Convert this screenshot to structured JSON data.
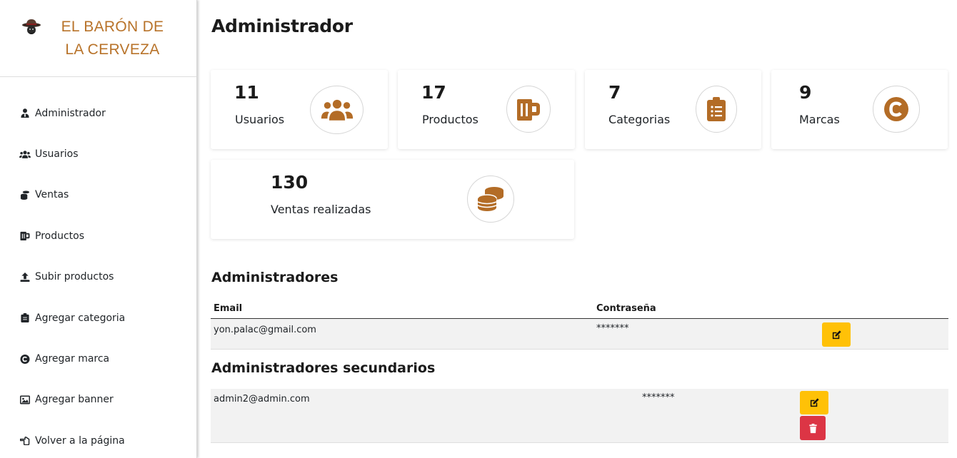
{
  "brand": {
    "name": "EL BARÓN DE LA CERVEZA",
    "logo_icon": "baron-hat-logo-icon",
    "color": "#b8732a"
  },
  "sidebar": {
    "items": [
      {
        "label": "Administrador",
        "icon": "user-tie-icon"
      },
      {
        "label": "Usuarios",
        "icon": "users-icon"
      },
      {
        "label": "Ventas",
        "icon": "coins-icon"
      },
      {
        "label": "Productos",
        "icon": "beer-mug-icon"
      },
      {
        "label": "Subir productos",
        "icon": "upload-icon"
      },
      {
        "label": "Agregar categoria",
        "icon": "clipboard-icon"
      },
      {
        "label": "Agregar marca",
        "icon": "copyright-icon"
      },
      {
        "label": "Agregar banner",
        "icon": "image-icon"
      },
      {
        "label": "Volver a la página",
        "icon": "hand-point-left-icon"
      }
    ]
  },
  "page": {
    "title": "Administrador"
  },
  "stats": [
    {
      "value": "11",
      "label": "Usuarios",
      "icon": "users-icon"
    },
    {
      "value": "17",
      "label": "Productos",
      "icon": "beer-mug-icon"
    },
    {
      "value": "7",
      "label": "Categorias",
      "icon": "clipboard-list-icon"
    },
    {
      "value": "9",
      "label": "Marcas",
      "icon": "copyright-icon"
    },
    {
      "value": "130",
      "label": "Ventas realizadas",
      "icon": "coins-icon"
    }
  ],
  "accent_color": "#b36c26",
  "admins": {
    "title": "Administradores",
    "headers": {
      "email": "Email",
      "password": "Contraseña"
    },
    "rows": [
      {
        "email": "yon.palac@gmail.com",
        "password": "*******"
      }
    ]
  },
  "secondary_admins": {
    "title": "Administradores secundarios",
    "rows": [
      {
        "email": "admin2@admin.com",
        "password": "*******"
      }
    ]
  },
  "colors": {
    "edit_button": "#ffc107",
    "delete_button": "#dc3545"
  }
}
